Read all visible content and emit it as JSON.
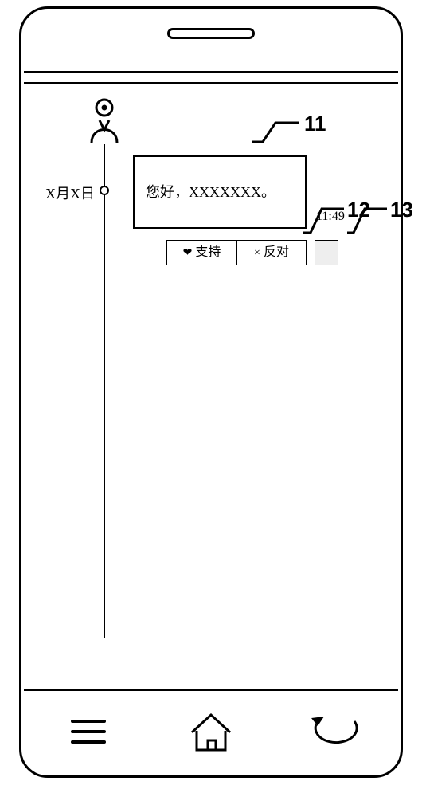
{
  "timeline": {
    "date_label": "X月X日",
    "message": "您好，XXXXXXX。",
    "timestamp": "11:49"
  },
  "buttons": {
    "support": {
      "label": "支持",
      "icon": "❤"
    },
    "oppose": {
      "label": "反对",
      "icon": "×"
    }
  },
  "callouts": {
    "message_card": "11",
    "oppose_button": "12",
    "extra_button": "13"
  },
  "icons": {
    "avatar": "user-icon",
    "menu": "menu-icon",
    "home": "home-icon",
    "back": "back-icon"
  }
}
